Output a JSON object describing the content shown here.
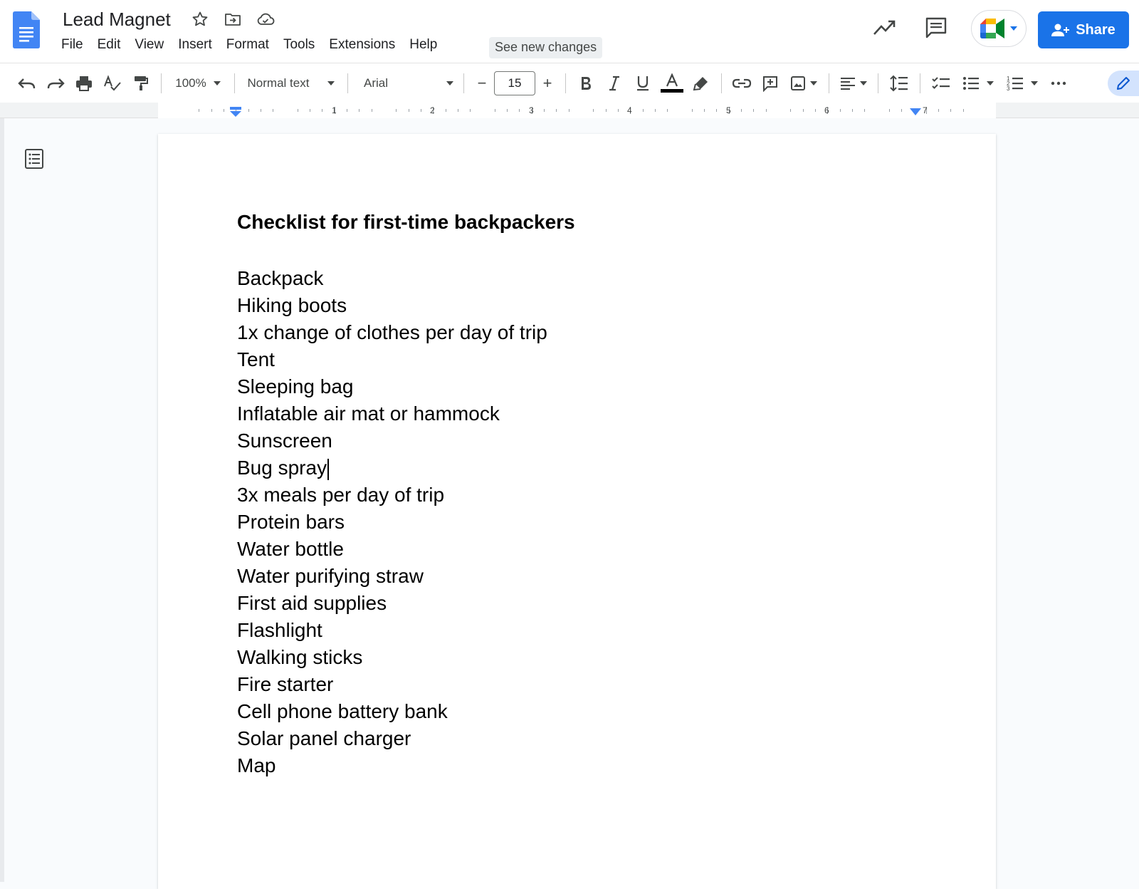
{
  "header": {
    "title": "Lead Magnet",
    "menu": [
      "File",
      "Edit",
      "View",
      "Insert",
      "Format",
      "Tools",
      "Extensions",
      "Help"
    ],
    "see_new_changes": "See new changes",
    "share_label": "Share"
  },
  "toolbar": {
    "zoom": "100%",
    "style": "Normal text",
    "font": "Arial",
    "font_size": "15",
    "minus": "−",
    "plus": "+"
  },
  "ruler": {
    "numbers": [
      "1",
      "2",
      "3",
      "4",
      "5",
      "6",
      "7"
    ]
  },
  "document": {
    "heading": "Checklist for first-time backpackers",
    "items": [
      "Backpack",
      "Hiking boots",
      "1x change of clothes per day of trip",
      "Tent",
      "Sleeping bag",
      "Inflatable air mat or hammock",
      "Sunscreen",
      "Bug spray",
      "3x meals per day of trip",
      "Protein bars",
      "Water bottle",
      "Water purifying straw",
      "First aid supplies",
      "Flashlight",
      "Walking sticks",
      "Fire starter",
      "Cell phone battery bank",
      "Solar panel charger",
      "Map"
    ],
    "cursor_after_item": 7
  },
  "colors": {
    "accent": "#1a73e8",
    "doc_logo": "#4285f4",
    "text_color_bar": "#000000"
  },
  "icons": {
    "title": [
      "star-icon",
      "move-to-folder-icon",
      "cloud-saved-icon"
    ],
    "header_right": [
      "activity-trend-icon",
      "comments-icon",
      "meet-icon",
      "person-add-icon"
    ],
    "toolbar": [
      "undo-icon",
      "redo-icon",
      "print-icon",
      "spellcheck-icon",
      "paint-format-icon",
      "bold-icon",
      "italic-icon",
      "underline-icon",
      "text-color-icon",
      "highlight-icon",
      "link-icon",
      "add-comment-icon",
      "insert-image-icon",
      "align-left-icon",
      "line-spacing-icon",
      "checklist-icon",
      "bulleted-list-icon",
      "numbered-list-icon",
      "more-icon",
      "editing-mode-pencil-icon"
    ]
  }
}
